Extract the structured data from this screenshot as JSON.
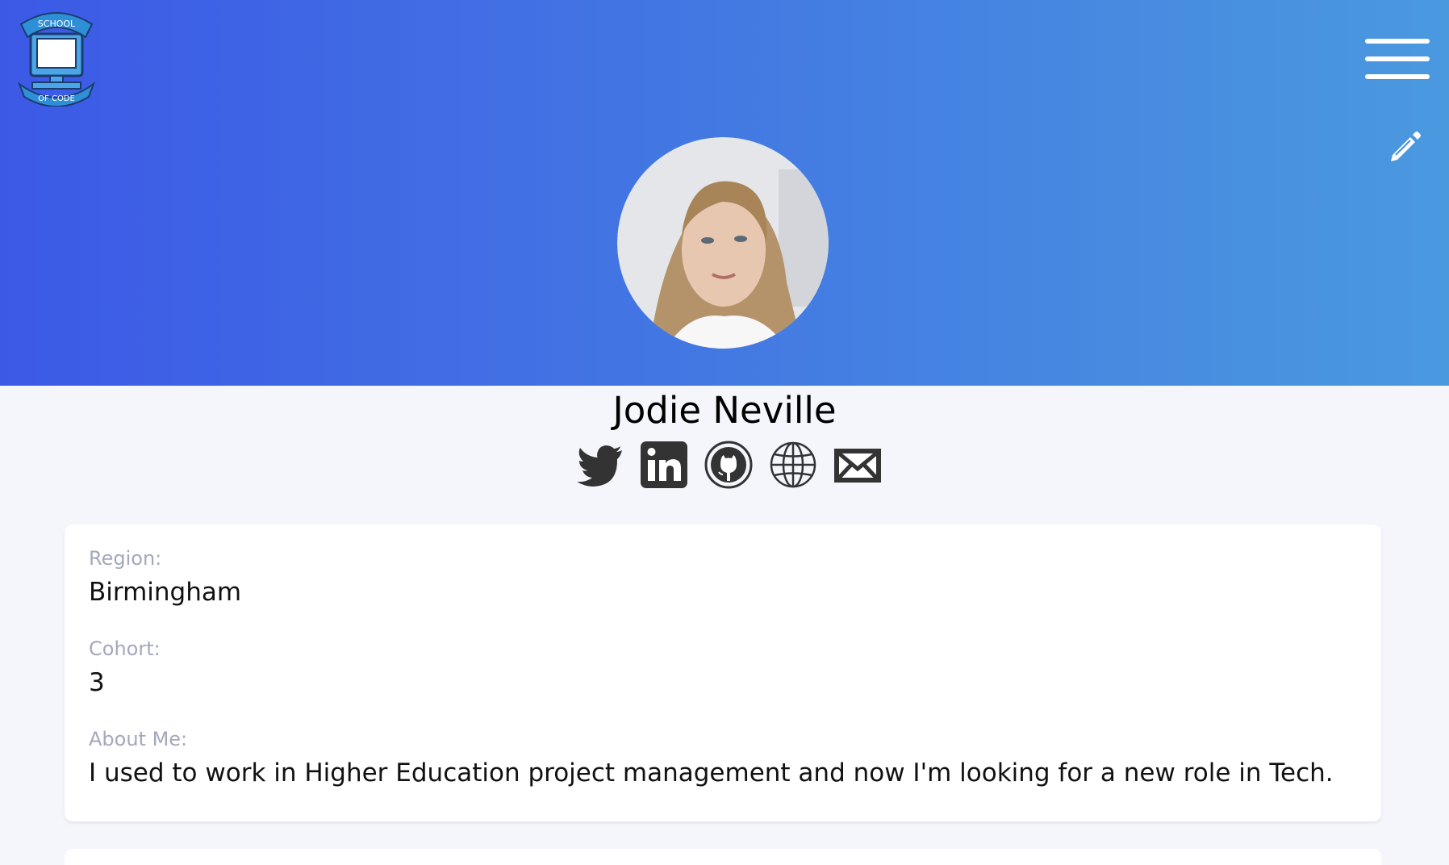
{
  "header": {
    "logo_text_top": "SCHOOL",
    "logo_text_bottom": "OF CODE",
    "gradient_start": "#3c59e6",
    "gradient_end": "#4a99df"
  },
  "profile": {
    "name": "Jodie Neville"
  },
  "socials": [
    "twitter-icon",
    "linkedin-icon",
    "github-icon",
    "globe-icon",
    "envelope-icon"
  ],
  "details": {
    "region_label": "Region:",
    "region_value": "Birmingham",
    "cohort_label": "Cohort:",
    "cohort_value": "3",
    "about_label": "About Me:",
    "about_value": "I used to work in Higher Education project management and now I'm looking for a new role in Tech."
  }
}
